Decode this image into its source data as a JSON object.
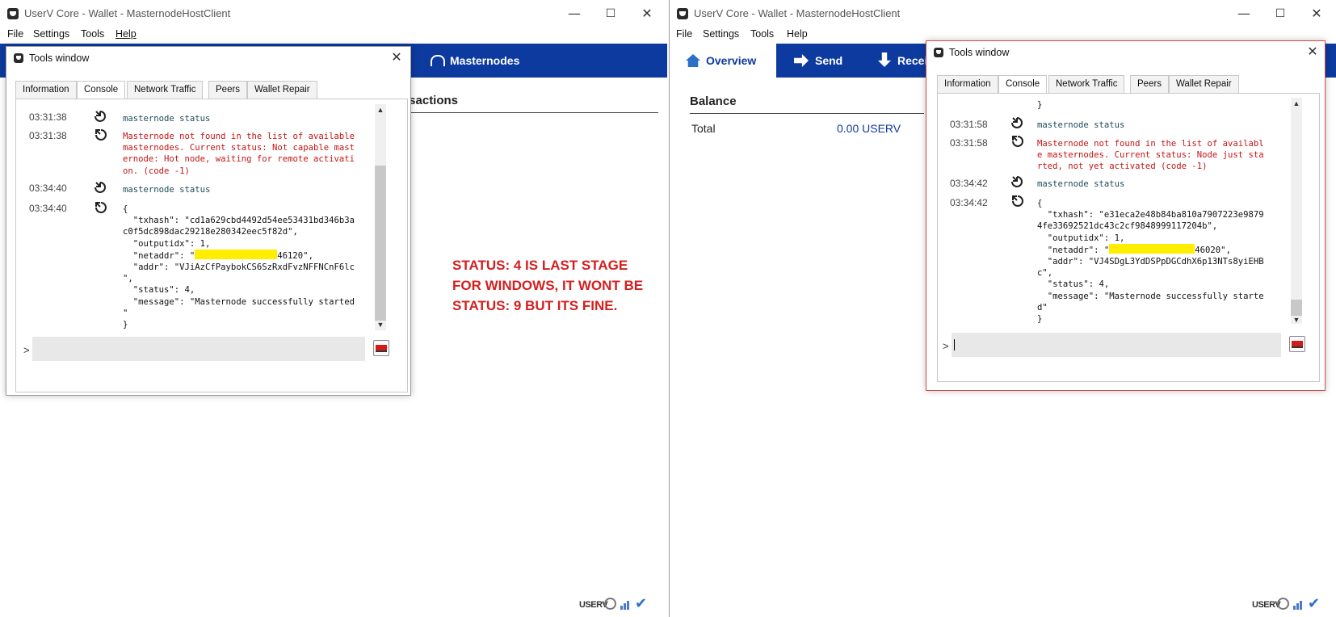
{
  "left_window": {
    "title": "UserV Core - Wallet - MasternodeHostClient",
    "menu": [
      "File",
      "Settings",
      "Tools",
      "Help"
    ],
    "nav_visible_tab": "Masternodes",
    "partial_section_heading": "nsactions",
    "statusbar_label": "USERV"
  },
  "right_window": {
    "title": "UserV Core - Wallet - MasternodeHostClient",
    "menu": [
      "File",
      "Settings",
      "Tools",
      "Help"
    ],
    "nav_tabs": [
      "Overview",
      "Send",
      "Recei"
    ],
    "balance_heading": "Balance",
    "total_label": "Total",
    "total_value": "0.00 USERV",
    "statusbar_label": "USERV"
  },
  "left_tools": {
    "title": "Tools window",
    "tabs": [
      "Information",
      "Console",
      "Network Traffic",
      "Peers",
      "Wallet Repair"
    ],
    "active_tab": "Console",
    "entries": [
      {
        "time": "03:31:38",
        "dir": "out",
        "kind": "cmd",
        "text": "masternode status"
      },
      {
        "time": "03:31:38",
        "dir": "in",
        "kind": "err",
        "text": "Masternode not found in the list of available\nmasternodes. Current status: Not capable mast\nernode: Hot node, waiting for remote activati\non. (code -1)"
      },
      {
        "time": "03:34:40",
        "dir": "out",
        "kind": "cmd",
        "text": "masternode status"
      },
      {
        "time": "03:34:40",
        "dir": "in",
        "kind": "json",
        "text_before": "{\n  \"txhash\": \"cd1a629cbd4492d54ee53431bd346b3a\nc0f5dc898dac29218e280342eec5f82d\",\n  \"outputidx\": 1,\n  \"netaddr\": \"",
        "redacted_suffix": "46120\",",
        "text_after": "  \"addr\": \"VJiAzCfPaybokCS6SzRxdFvzNFFNCnF6lc\n\",\n  \"status\": 4,\n  \"message\": \"Masternode successfully started\n\"\n}"
      }
    ],
    "prompt": ">"
  },
  "right_tools": {
    "title": "Tools window",
    "tabs": [
      "Information",
      "Console",
      "Network Traffic",
      "Peers",
      "Wallet Repair"
    ],
    "active_tab": "Console",
    "top_fragment": "}",
    "entries": [
      {
        "time": "03:31:58",
        "dir": "out",
        "kind": "cmd",
        "text": "masternode status"
      },
      {
        "time": "03:31:58",
        "dir": "in",
        "kind": "err",
        "text": "Masternode not found in the list of availabl\ne masternodes. Current status: Node just sta\nrted, not yet activated (code -1)"
      },
      {
        "time": "03:34:42",
        "dir": "out",
        "kind": "cmd",
        "text": "masternode status"
      },
      {
        "time": "03:34:42",
        "dir": "in",
        "kind": "json",
        "text_before": "{\n  \"txhash\": \"e31eca2e48b84ba810a7907223e9879\n4fe33692521dc43c2cf9848999117204b\",\n  \"outputidx\": 1,\n  \"netaddr\": \"",
        "redacted_suffix": "46020\",",
        "text_after": "  \"addr\": \"VJ4SDgL3YdDSPpDGCdhX6p13NTs8yiEHB\nc\",\n  \"status\": 4,\n  \"message\": \"Masternode successfully starte\nd\"\n}"
      }
    ],
    "prompt": ">"
  },
  "annotation": "STATUS: 4 IS LAST STAGE FOR WINDOWS, IT WONT BE STATUS: 9 BUT ITS FINE.",
  "colors": {
    "nav_blue": "#0d3a9e",
    "error_red": "#c21515",
    "command_teal": "#1e4b5a",
    "annotation_red": "#d41f1f",
    "redaction_yellow": "#ffee00"
  }
}
